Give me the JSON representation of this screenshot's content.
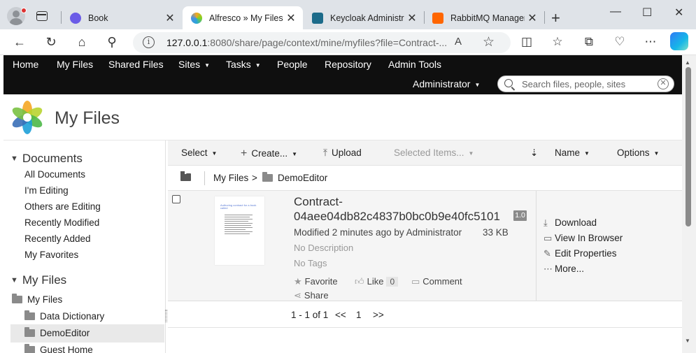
{
  "browser": {
    "tabs": [
      {
        "label": "Book",
        "favicon_color": "#6b5ce7"
      },
      {
        "label": "Alfresco » My Files",
        "favicon_color": "#2aa5d8"
      },
      {
        "label": "Keycloak Administra",
        "favicon_color": "#1c6b8a"
      },
      {
        "label": "RabbitMQ Managem",
        "favicon_color": "#ff6600"
      }
    ],
    "url_host": "127.0.0.1",
    "url_rest": ":8080/share/page/context/mine/myfiles?file=Contract-..."
  },
  "header": {
    "nav": [
      "Home",
      "My Files",
      "Shared Files",
      "Sites",
      "Tasks",
      "People",
      "Repository",
      "Admin Tools"
    ],
    "user": "Administrator",
    "search_placeholder": "Search files, people, sites"
  },
  "page": {
    "title": "My Files"
  },
  "sidebar": {
    "documents_heading": "Documents",
    "documents_links": [
      "All Documents",
      "I'm Editing",
      "Others are Editing",
      "Recently Modified",
      "Recently Added",
      "My Favorites"
    ],
    "myfiles_heading": "My Files",
    "tree": [
      "My Files",
      "Data Dictionary",
      "DemoEditor",
      "Guest Home"
    ]
  },
  "toolbar": {
    "select": "Select",
    "create": "Create...",
    "upload": "Upload",
    "selected_items": "Selected Items...",
    "sort": "Name",
    "options": "Options"
  },
  "breadcrumb": {
    "root": "My Files",
    "sep": ">",
    "current": "DemoEditor"
  },
  "document": {
    "name_line1": "Contract-",
    "name_line2": "04aee04db82c4837b0bc0b9e40fc5101",
    "version": "1.0",
    "modified": "Modified 2 minutes ago by Administrator",
    "size": "33 KB",
    "description": "No Description",
    "tags": "No Tags",
    "favorite": "Favorite",
    "like": "Like",
    "like_count": "0",
    "comment": "Comment",
    "share": "Share",
    "thumb_title": "Authoring contract for a book called 'Buying'Buying'Buying''"
  },
  "actions": [
    "Download",
    "View In Browser",
    "Edit Properties",
    "More..."
  ],
  "paging": {
    "range": "1 - 1 of 1",
    "prev": "<<",
    "page": "1",
    "next": ">>"
  }
}
